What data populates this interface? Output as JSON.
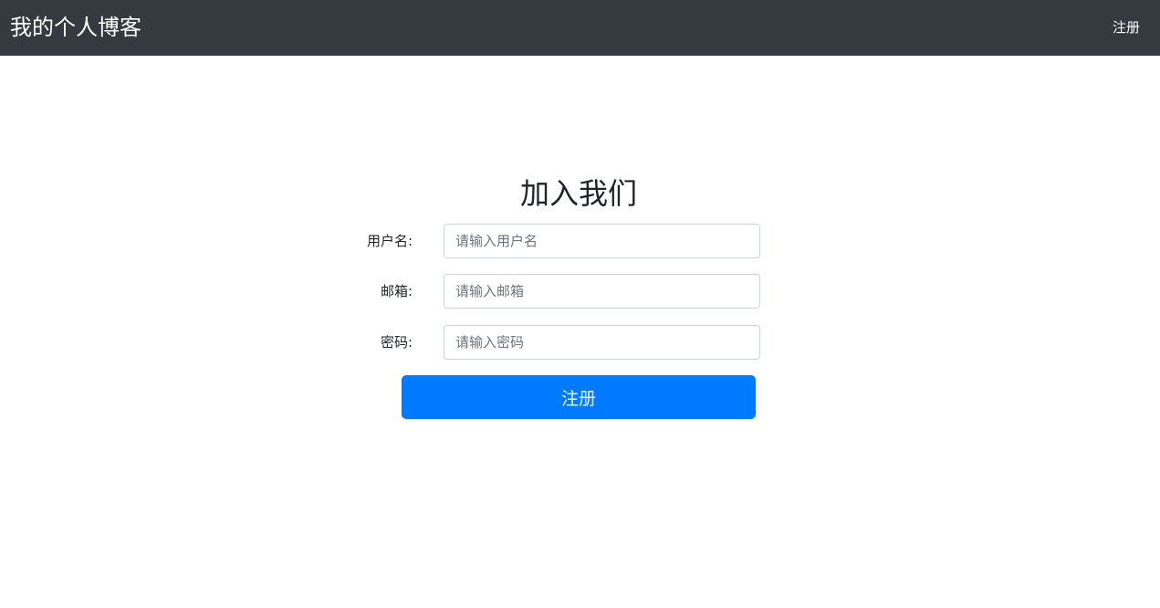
{
  "navbar": {
    "brand": "我的个人博客",
    "register_link": "注册",
    "background_color": "#343a40"
  },
  "main": {
    "title": "加入我们",
    "fields": [
      {
        "label": "用户名:",
        "value": "",
        "placeholder": "请输入用户名"
      },
      {
        "label": "邮箱:",
        "value": "",
        "placeholder": "请输入邮箱"
      },
      {
        "label": "密码:",
        "value": "",
        "placeholder": "请输入密码"
      }
    ],
    "submit_label": "注册",
    "accent_color": "#007bff"
  }
}
